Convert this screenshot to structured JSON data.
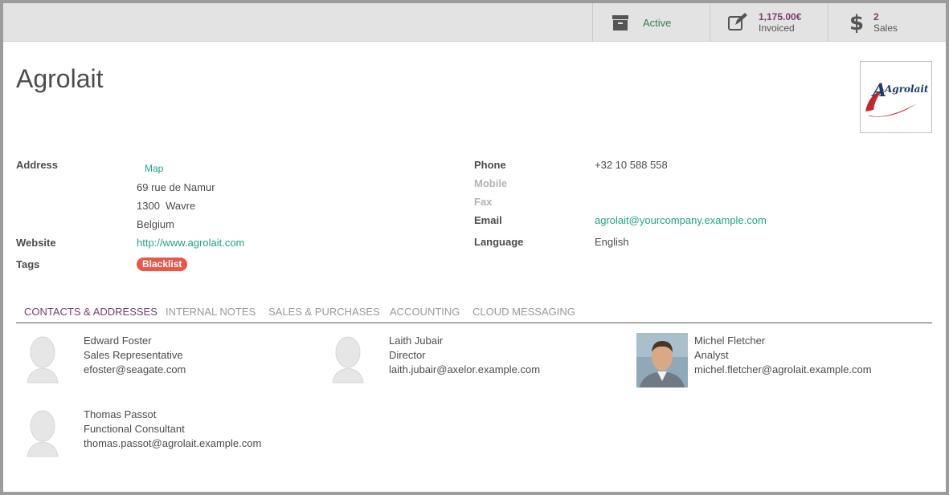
{
  "header": {
    "active_label": "Active",
    "invoiced_value": "1,175.00€",
    "invoiced_label": "Invoiced",
    "sales_value": "2",
    "sales_label": "Sales"
  },
  "partner": {
    "name": "Agrolait",
    "logo_text": "Agrolait",
    "address_label": "Address",
    "map_link": "Map",
    "street": "69 rue de Namur",
    "city_line": "1300  Wavre",
    "country": "Belgium",
    "website_label": "Website",
    "website": "http://www.agrolait.com",
    "tags_label": "Tags",
    "tag": "Blacklist",
    "phone_label": "Phone",
    "phone": "+32 10 588 558",
    "mobile_label": "Mobile",
    "fax_label": "Fax",
    "email_label": "Email",
    "email": "agrolait@yourcompany.example.com",
    "language_label": "Language",
    "language": "English"
  },
  "tabs": [
    {
      "label": "CONTACTS & ADDRESSES"
    },
    {
      "label": "INTERNAL NOTES"
    },
    {
      "label": "SALES & PURCHASES"
    },
    {
      "label": "ACCOUNTING"
    },
    {
      "label": "CLOUD MESSAGING"
    }
  ],
  "contacts": [
    {
      "name": "Edward Foster",
      "role": "Sales Representative",
      "email": "efoster@seagate.com",
      "avatar": "placeholder"
    },
    {
      "name": "Laith Jubair",
      "role": "Director",
      "email": "laith.jubair@axelor.example.com",
      "avatar": "placeholder"
    },
    {
      "name": "Michel Fletcher",
      "role": "Analyst",
      "email": "michel.fletcher@agrolait.example.com",
      "avatar": "photo"
    },
    {
      "name": "Thomas Passot",
      "role": "Functional Consultant",
      "email": "thomas.passot@agrolait.example.com",
      "avatar": "placeholder"
    }
  ],
  "colors": {
    "accent": "#7c3d6f",
    "link": "#21a38a",
    "tag": "#e8574a",
    "buttonbar": "#e3e3e3"
  }
}
